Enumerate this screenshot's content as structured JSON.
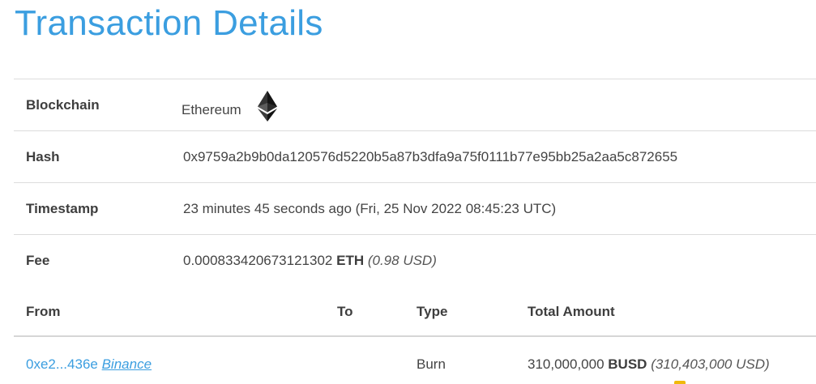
{
  "page": {
    "title": "Transaction Details"
  },
  "details": {
    "blockchain": {
      "label": "Blockchain",
      "value": "Ethereum",
      "icon": "ethereum-icon"
    },
    "hash": {
      "label": "Hash",
      "value": "0x9759a2b9b0da120576d5220b5a87b3dfa9a75f0111b77e95bb25a2aa5c872655"
    },
    "timestamp": {
      "label": "Timestamp",
      "value": "23 minutes 45 seconds ago (Fri, 25 Nov 2022 08:45:23 UTC)"
    },
    "fee": {
      "label": "Fee",
      "amount": "0.000833420673121302",
      "unit": "ETH",
      "usd": "(0.98 USD)"
    }
  },
  "transfers": {
    "headers": {
      "from": "From",
      "to": "To",
      "type": "Type",
      "amount": "Total Amount"
    },
    "rows": [
      {
        "from_address": "0xe2...436e",
        "from_entity": "Binance",
        "to": "",
        "type": "Burn",
        "amount": "310,000,000",
        "symbol": "BUSD",
        "usd": "(310,403,000 USD)"
      }
    ]
  },
  "colors": {
    "accent": "#3b9ee0",
    "text": "#444444",
    "border": "#dcdcdc",
    "busd": "#f0b90b"
  }
}
